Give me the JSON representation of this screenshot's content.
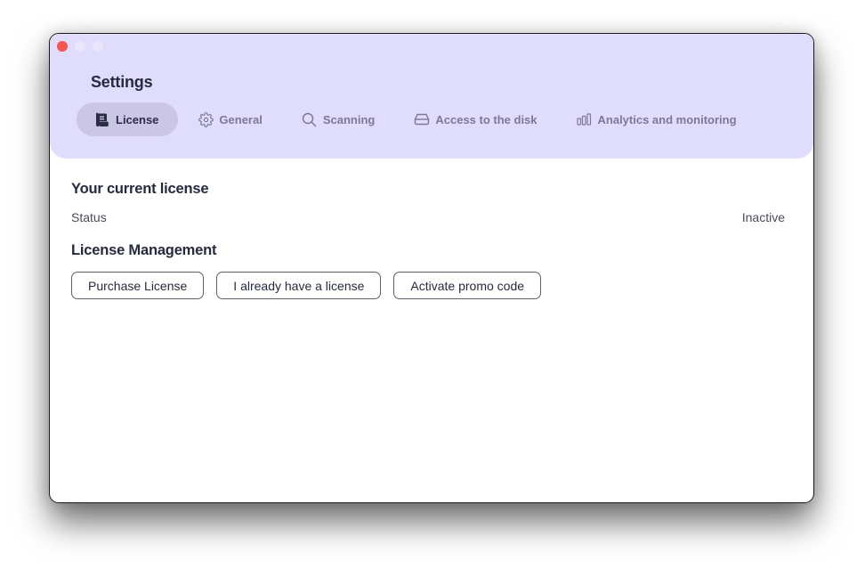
{
  "window": {
    "title": "Settings",
    "traffic_lights": {
      "close_color": "#f5564e",
      "minimize_color": "#e9e6fc",
      "maximize_color": "#e9e6fc"
    }
  },
  "tabs": [
    {
      "label": "License",
      "icon": "scroll-icon",
      "active": true
    },
    {
      "label": "General",
      "icon": "gear-icon",
      "active": false
    },
    {
      "label": "Scanning",
      "icon": "search-icon",
      "active": false
    },
    {
      "label": "Access to the disk",
      "icon": "disk-icon",
      "active": false
    },
    {
      "label": "Analytics and monitoring",
      "icon": "bar-chart-icon",
      "active": false
    }
  ],
  "license": {
    "current_heading": "Your current license",
    "status_label": "Status",
    "status_value": "Inactive",
    "management_heading": "License Management",
    "buttons": {
      "purchase": "Purchase License",
      "have_license": "I already have a license",
      "promo": "Activate promo code"
    }
  },
  "colors": {
    "header_bg": "#e0dcfb",
    "active_tab_bg": "#cbc6e6",
    "text_dark": "#262a40",
    "tab_inactive": "#7d7896"
  }
}
